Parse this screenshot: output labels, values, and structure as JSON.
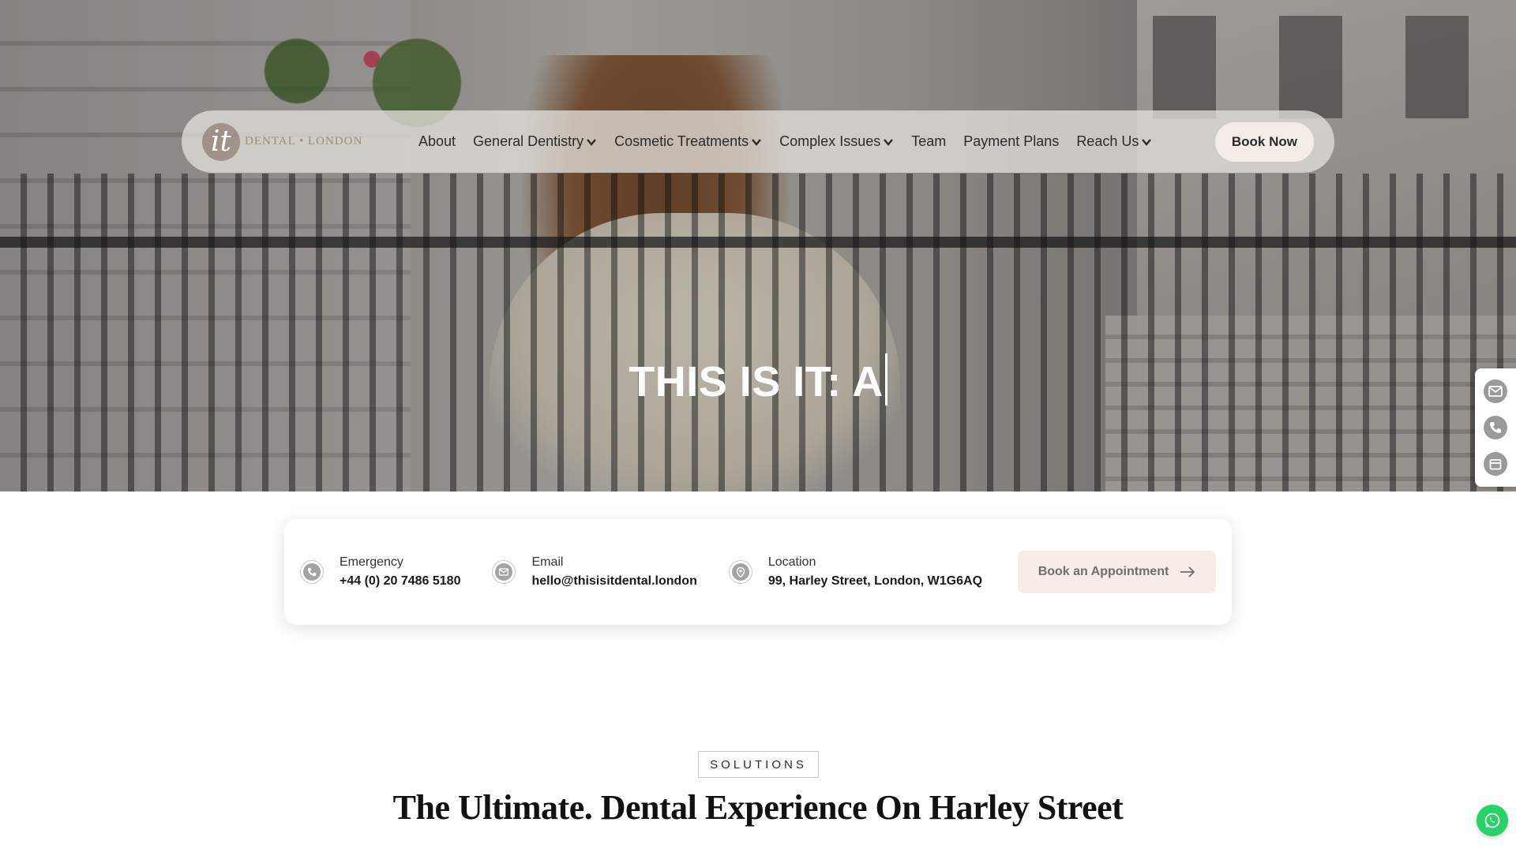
{
  "nav": {
    "logo_mark": "it",
    "logo_text": "DENTAL • LONDON",
    "items": [
      {
        "label": "About"
      },
      {
        "label": "General Dentistry"
      },
      {
        "label": "Cosmetic Treatments"
      },
      {
        "label": "Complex Issues"
      },
      {
        "label": "Team"
      },
      {
        "label": "Payment Plans"
      },
      {
        "label": "Reach Us"
      }
    ],
    "book_now": "Book Now"
  },
  "hero": {
    "headline": "THIS IS IT: A"
  },
  "info": {
    "emergency_label": "Emergency",
    "emergency_value": "+44 (0) 20 7486 5180",
    "email_label": "Email",
    "email_value": "hello@thisisitdental.london",
    "location_label": "Location",
    "location_value": "99, Harley Street, London, W1G6AQ",
    "appointment_button": "Book an Appointment"
  },
  "solutions": {
    "tag": "SOLUTIONS",
    "title": "The Ultimate. Dental Experience On Harley Street"
  },
  "icons": {
    "side_tab": [
      "email-icon",
      "phone-icon",
      "calendar-icon"
    ],
    "whatsapp": "whatsapp-icon"
  },
  "colors": {
    "accent_pink": "#f5ece8",
    "whatsapp_green": "#25d366"
  }
}
